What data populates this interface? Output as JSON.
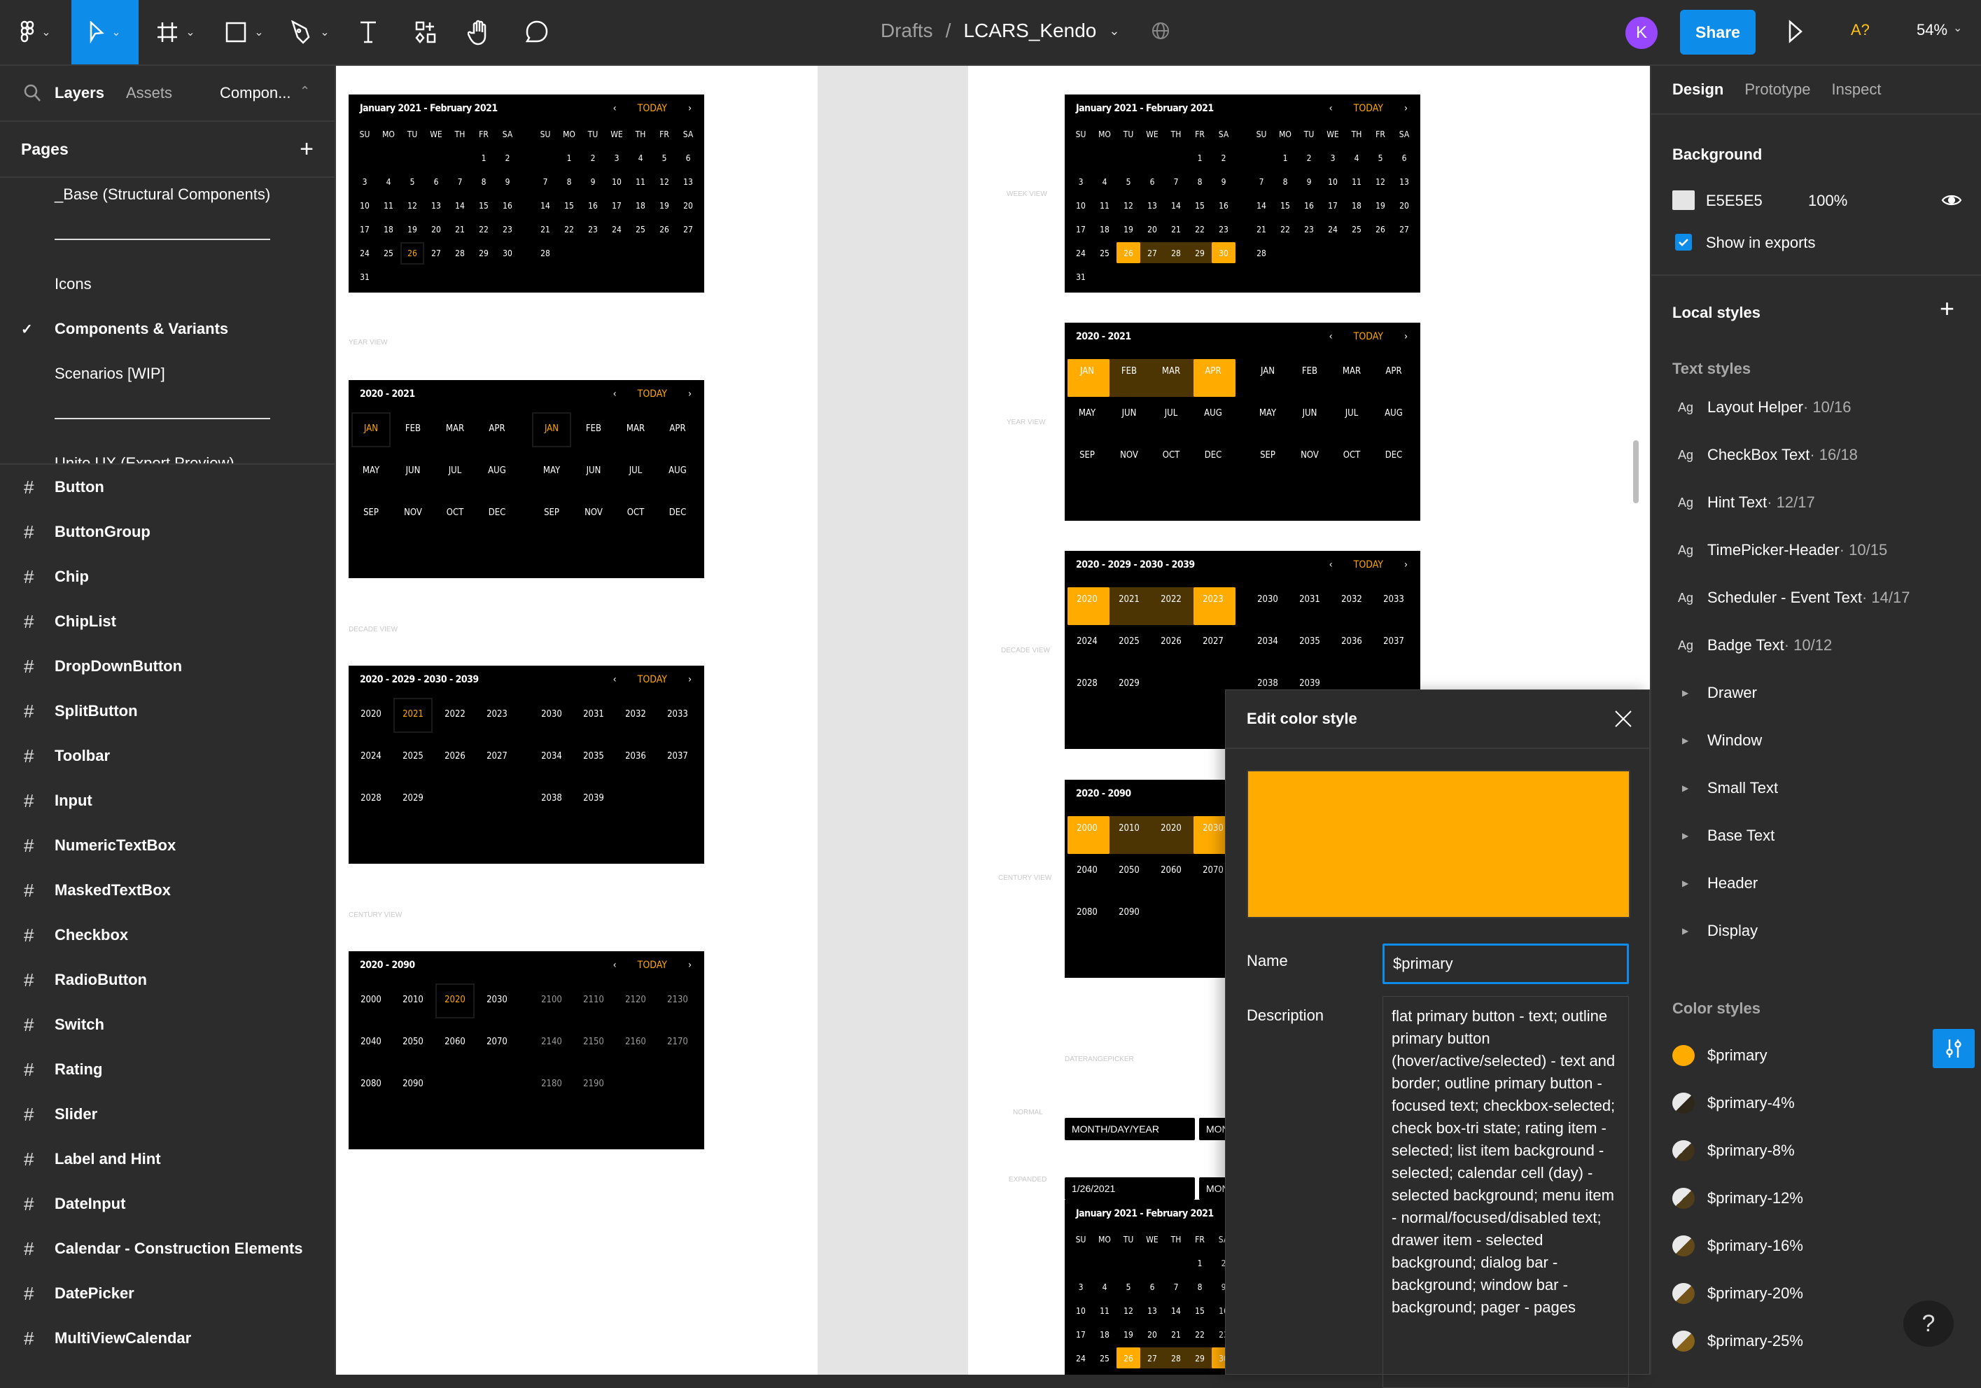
{
  "toolbar": {
    "breadcrumb_parent": "Drafts",
    "breadcrumb_sep": "/",
    "file_name": "LCARS_Kendo",
    "avatar_initial": "K",
    "share_label": "Share",
    "a11y_label": "A?",
    "zoom_level": "54%",
    "accent_color": "#0d8ce9",
    "avatar_color": "#9747ff"
  },
  "left_panel": {
    "tabs": [
      "Layers",
      "Assets"
    ],
    "page_dropdown": "Compon...",
    "pages_title": "Pages",
    "pages": [
      {
        "label": "_Base (Structural Components)",
        "type": "page"
      },
      {
        "label": "",
        "type": "separator"
      },
      {
        "label": "Icons",
        "type": "page"
      },
      {
        "label": "Components & Variants",
        "type": "page",
        "current": true
      },
      {
        "label": "Scenarios [WIP]",
        "type": "page"
      },
      {
        "label": "",
        "type": "separator"
      },
      {
        "label": "Unite UX (Export Preview)",
        "type": "page"
      }
    ],
    "layers": [
      "Button",
      "ButtonGroup",
      "Chip",
      "ChipList",
      "DropDownButton",
      "SplitButton",
      "Toolbar",
      "Input",
      "NumericTextBox",
      "MaskedTextBox",
      "Checkbox",
      "RadioButton",
      "Switch",
      "Rating",
      "Slider",
      "Label and Hint",
      "DateInput",
      "Calendar - Construction Elements",
      "DatePicker",
      "MultiViewCalendar"
    ]
  },
  "canvas": {
    "today_label": "TODAY",
    "weekdays": [
      "SU",
      "MO",
      "TU",
      "WE",
      "TH",
      "FR",
      "SA"
    ],
    "month_title": "January 2021 - February 2021",
    "january": [
      [
        "",
        "",
        "",
        "",
        "",
        "1",
        "2"
      ],
      [
        "3",
        "4",
        "5",
        "6",
        "7",
        "8",
        "9"
      ],
      [
        "10",
        "11",
        "12",
        "13",
        "14",
        "15",
        "16"
      ],
      [
        "17",
        "18",
        "19",
        "20",
        "21",
        "22",
        "23"
      ],
      [
        "24",
        "25",
        "26",
        "27",
        "28",
        "29",
        "30"
      ],
      [
        "31",
        "",
        "",
        "",
        "",
        "",
        ""
      ]
    ],
    "february": [
      [
        "",
        "1",
        "2",
        "3",
        "4",
        "5",
        "6"
      ],
      [
        "7",
        "8",
        "9",
        "10",
        "11",
        "12",
        "13"
      ],
      [
        "14",
        "15",
        "16",
        "17",
        "18",
        "19",
        "20"
      ],
      [
        "21",
        "22",
        "23",
        "24",
        "25",
        "26",
        "27"
      ],
      [
        "28",
        "",
        "",
        "",
        "",
        "",
        ""
      ]
    ],
    "year_title": "2020 - 2021",
    "months": [
      "JAN",
      "FEB",
      "MAR",
      "APR",
      "MAY",
      "JUN",
      "JUL",
      "AUG",
      "SEP",
      "NOV",
      "OCT",
      "DEC"
    ],
    "decade_title": "2020 - 2029 - 2030 - 2039",
    "decade_left": [
      "2020",
      "2021",
      "2022",
      "2023",
      "2024",
      "2025",
      "2026",
      "2027",
      "2028",
      "2029"
    ],
    "decade_right": [
      "2030",
      "2031",
      "2032",
      "2033",
      "2034",
      "2035",
      "2036",
      "2037",
      "2038",
      "2039"
    ],
    "century_title": "2020 - 2090",
    "century_left": [
      "2000",
      "2010",
      "2020",
      "2030",
      "2040",
      "2050",
      "2060",
      "2070",
      "2080",
      "2090"
    ],
    "century_right": [
      "2100",
      "2110",
      "2120",
      "2130",
      "2140",
      "2150",
      "2160",
      "2170",
      "2180",
      "2190"
    ],
    "labels": {
      "week_view": "WEEK VIEW",
      "year_view": "YEAR VIEW",
      "decade_view": "DECADE VIEW",
      "century_view": "CENTURY VIEW",
      "daterangepicker": "DATERANGEPICKER",
      "normal": "NORMAL",
      "expanded": "EXPANDED"
    },
    "date_placeholder": "MONTH/DAY/YEAR",
    "date_placeholder_cut": "MONT",
    "date_value": "1/26/2021",
    "primary_color": "#ffab00",
    "range_mid_color": "#4d3503"
  },
  "dialog": {
    "title": "Edit color style",
    "preview_color": "#ffab00",
    "name_label": "Name",
    "name_value": "$primary",
    "description_label": "Description",
    "description_value": "flat primary button - text; outline primary button (hover/active/selected) - text and border; outline primary button - focused text; checkbox-selected; check box-tri state; rating item - selected; list item background - selected; calendar cell (day) - selected background; menu item - normal/focused/disabled text; drawer item - selected background; dialog bar - background; window bar - background; pager - pages"
  },
  "right_panel": {
    "tabs": [
      "Design",
      "Prototype",
      "Inspect"
    ],
    "background_title": "Background",
    "background_hex": "E5E5E5",
    "background_opacity": "100%",
    "show_in_exports_label": "Show in exports",
    "show_in_exports_checked": true,
    "local_styles_title": "Local styles",
    "text_styles_title": "Text styles",
    "text_styles": [
      {
        "name": "Layout Helper",
        "meta": " · 10/16"
      },
      {
        "name": "CheckBox Text",
        "meta": " · 16/18"
      },
      {
        "name": "Hint Text",
        "meta": " · 12/17"
      },
      {
        "name": "TimePicker-Header",
        "meta": " · 10/15"
      },
      {
        "name": "Scheduler - Event Text",
        "meta": " · 14/17"
      },
      {
        "name": "Badge Text",
        "meta": " · 10/12"
      }
    ],
    "text_groups": [
      "Drawer",
      "Window",
      "Small Text",
      "Base Text",
      "Header",
      "Display"
    ],
    "color_styles_title": "Color styles",
    "color_styles": [
      {
        "name": "$primary",
        "alpha": 1
      },
      {
        "name": "$primary-4%",
        "alpha": 0.04
      },
      {
        "name": "$primary-8%",
        "alpha": 0.08
      },
      {
        "name": "$primary-12%",
        "alpha": 0.12
      },
      {
        "name": "$primary-16%",
        "alpha": 0.16
      },
      {
        "name": "$primary-20%",
        "alpha": 0.2
      },
      {
        "name": "$primary-25%",
        "alpha": 0.25
      }
    ],
    "help_label": "?"
  }
}
